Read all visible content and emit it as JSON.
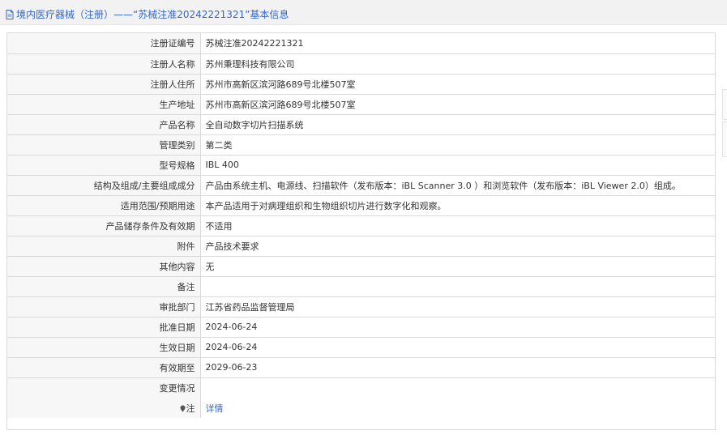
{
  "header": {
    "title": "境内医疗器械（注册）——“苏械注准20242221321”基本信息"
  },
  "rows": [
    {
      "label": "注册证编号",
      "value": "苏械注准20242221321"
    },
    {
      "label": "注册人名称",
      "value": "苏州秉理科技有限公司"
    },
    {
      "label": "注册人住所",
      "value": "苏州市高新区滨河路689号北楼507室"
    },
    {
      "label": "生产地址",
      "value": "苏州市高新区滨河路689号北楼507室"
    },
    {
      "label": "产品名称",
      "value": "全自动数字切片扫描系统"
    },
    {
      "label": "管理类别",
      "value": "第二类"
    },
    {
      "label": "型号规格",
      "value": "IBL 400"
    },
    {
      "label": "结构及组成/主要组成成分",
      "value": "产品由系统主机、电源线、扫描软件（发布版本：iBL Scanner 3.0 ）和浏览软件（发布版本：iBL Viewer 2.0）组成。"
    },
    {
      "label": "适用范围/预期用途",
      "value": "本产品适用于对病理组织和生物组织切片进行数字化和观察。"
    },
    {
      "label": "产品储存条件及有效期",
      "value": "不适用"
    },
    {
      "label": "附件",
      "value": "产品技术要求"
    },
    {
      "label": "其他内容",
      "value": "无"
    },
    {
      "label": "备注",
      "value": ""
    },
    {
      "label": "审批部门",
      "value": "江苏省药品监督管理局"
    },
    {
      "label": "批准日期",
      "value": "2024-06-24"
    },
    {
      "label": "生效日期",
      "value": "2024-06-24"
    },
    {
      "label": "有效期至",
      "value": "2029-06-23"
    },
    {
      "label": "变更情况",
      "value": ""
    }
  ],
  "note_row": {
    "label": "注",
    "link": "详情"
  },
  "colors": {
    "link": "#3366cc",
    "label_bg": "#f7f7f7",
    "border": "#d9d9d9"
  }
}
